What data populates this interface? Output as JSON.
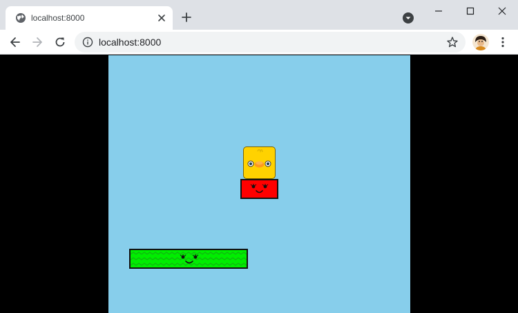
{
  "browser": {
    "tab": {
      "title": "localhost:8000",
      "favicon": "globe-icon"
    },
    "address_bar": {
      "url": "localhost:8000",
      "security_icon": "info-icon"
    },
    "icons": {
      "new_tab": "plus-icon",
      "tab_search": "dropdown-icon",
      "back": "back-arrow-icon",
      "forward": "forward-arrow-icon",
      "reload": "reload-icon",
      "bookmark": "star-icon",
      "profile": "avatar",
      "menu": "kebab-menu-icon",
      "minimize": "minimize-icon",
      "maximize": "maximize-icon",
      "close": "close-icon"
    }
  },
  "game": {
    "background_color": "#87ceeb",
    "letterbox_color": "#000000",
    "entities": [
      {
        "name": "player-duck-block",
        "color": "#ffd200"
      },
      {
        "name": "red-block",
        "color": "#ff0000",
        "face": "smiling"
      },
      {
        "name": "green-block",
        "color": "#00ee00",
        "face": "smiling",
        "pattern": "zigzag"
      }
    ]
  }
}
